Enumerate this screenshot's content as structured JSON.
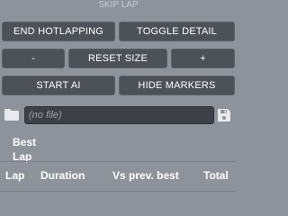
{
  "header": {
    "title": "SKIP LAP"
  },
  "buttons": {
    "end_hotlapping": "END HOTLAPPING",
    "toggle_detail": "TOGGLE DETAIL",
    "minus": "-",
    "reset_size": "RESET SIZE",
    "plus": "+",
    "start_ai": "START AI",
    "hide_markers": "HIDE MARKERS"
  },
  "file": {
    "placeholder": "(no file)"
  },
  "best_lap": {
    "line1": "Best",
    "line2": "Lap"
  },
  "table": {
    "columns": [
      "Lap",
      "Duration",
      "Vs prev. best",
      "Total"
    ]
  },
  "icons": {
    "folder": "folder-icon",
    "save": "save-icon"
  }
}
